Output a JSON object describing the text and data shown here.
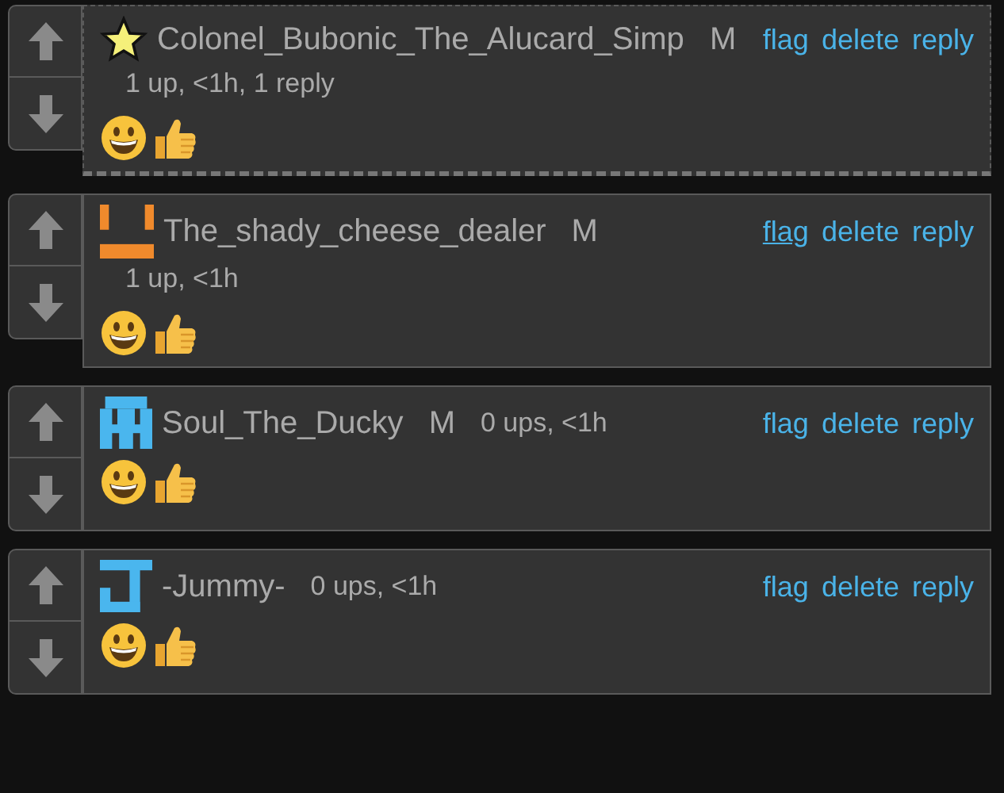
{
  "comments": [
    {
      "avatar": {
        "kind": "star"
      },
      "username": "Colonel_Bubonic_The_Alucard_Simp",
      "badge": "M",
      "meta": "1 up, <1h, 1 reply",
      "meta_inline": false,
      "has_replies": true,
      "actions": [
        {
          "label": "flag",
          "underlined": false
        },
        {
          "label": "delete",
          "underlined": false
        },
        {
          "label": "reply",
          "underlined": false
        }
      ],
      "emojis": [
        {
          "kind": "grin"
        },
        {
          "kind": "thumbs-up"
        }
      ]
    },
    {
      "avatar": {
        "kind": "face",
        "color": "#f08a2c"
      },
      "username": "The_shady_cheese_dealer",
      "badge": "M",
      "meta": "1 up, <1h",
      "meta_inline": false,
      "has_replies": false,
      "actions": [
        {
          "label": "flag",
          "underlined": true
        },
        {
          "label": "delete",
          "underlined": false
        },
        {
          "label": "reply",
          "underlined": false
        }
      ],
      "emojis": [
        {
          "kind": "grin"
        },
        {
          "kind": "thumbs-up"
        }
      ]
    },
    {
      "avatar": {
        "kind": "invader",
        "color": "#4ab6ee"
      },
      "username": "Soul_The_Ducky",
      "badge": "M",
      "meta": "0 ups, <1h",
      "meta_inline": true,
      "has_replies": false,
      "actions": [
        {
          "label": "flag",
          "underlined": false
        },
        {
          "label": "delete",
          "underlined": false
        },
        {
          "label": "reply",
          "underlined": false
        }
      ],
      "emojis": [
        {
          "kind": "grin"
        },
        {
          "kind": "thumbs-up"
        }
      ]
    },
    {
      "avatar": {
        "kind": "letter-j",
        "color": "#4ab6ee"
      },
      "username": "-Jummy-",
      "meta": "0 ups, <1h",
      "meta_inline": true,
      "has_replies": false,
      "actions": [
        {
          "label": "flag",
          "underlined": false
        },
        {
          "label": "delete",
          "underlined": false
        },
        {
          "label": "reply",
          "underlined": false
        }
      ],
      "emojis": [
        {
          "kind": "grin"
        },
        {
          "kind": "thumbs-up"
        }
      ]
    }
  ]
}
